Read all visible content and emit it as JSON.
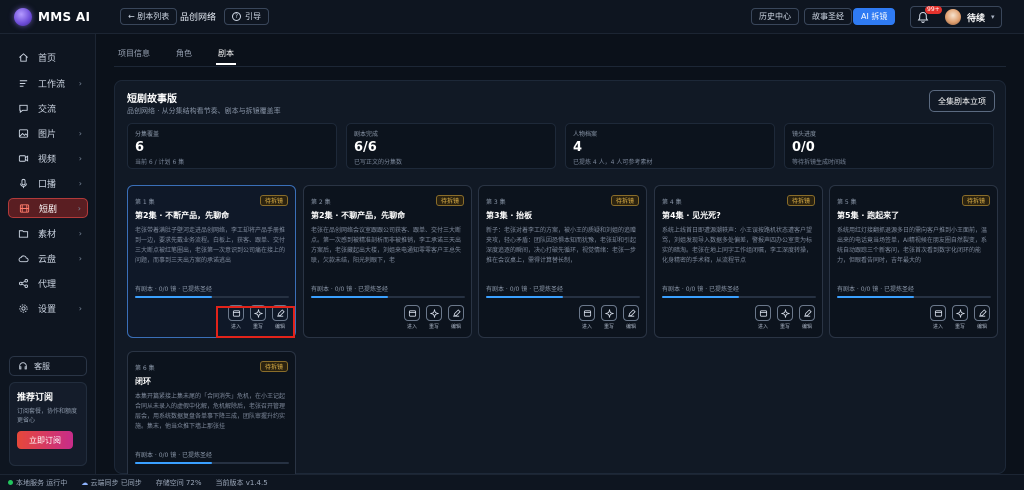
{
  "app": {
    "name": "MMS AI"
  },
  "header": {
    "back_label": "← 剧本列表",
    "project_title": "品创网络",
    "guide_label": "引导",
    "history_label": "历史中心",
    "series_label": "故事圣经",
    "ai_label": "AI 拆镜",
    "notification_count": "99+",
    "user_name": "待续"
  },
  "sidebar": {
    "items": [
      {
        "label": "首页",
        "icon": "home-icon",
        "has_chevron": false
      },
      {
        "label": "工作流",
        "icon": "workflow-icon",
        "has_chevron": true
      },
      {
        "label": "交流",
        "icon": "chat-icon",
        "has_chevron": false
      },
      {
        "label": "图片",
        "icon": "image-icon",
        "has_chevron": true
      },
      {
        "label": "视频",
        "icon": "video-icon",
        "has_chevron": true
      },
      {
        "label": "口播",
        "icon": "mic-icon",
        "has_chevron": true
      },
      {
        "label": "短剧",
        "icon": "film-icon",
        "has_chevron": true,
        "active": true
      },
      {
        "label": "素材",
        "icon": "folder-icon",
        "has_chevron": true
      },
      {
        "label": "云盘",
        "icon": "cloud-icon",
        "has_chevron": true
      },
      {
        "label": "代理",
        "icon": "share-icon",
        "has_chevron": false
      },
      {
        "label": "设置",
        "icon": "gear-icon",
        "has_chevron": true
      }
    ],
    "support_label": "客服",
    "promo": {
      "title": "推荐订阅",
      "desc": "订阅套餐，协作和额度更省心",
      "button": "立即订阅"
    }
  },
  "tabs": [
    {
      "label": "项目信息",
      "active": false
    },
    {
      "label": "角色",
      "active": false
    },
    {
      "label": "剧本",
      "active": true
    }
  ],
  "panel": {
    "title": "短剧故事版",
    "subtitle": "品创网络 · 从分集结构看节奏、剧本与拆镜覆盖率",
    "all_button": "全集剧本立项"
  },
  "stats": [
    {
      "label": "分集覆盖",
      "value": "6",
      "note": "当前 6 / 计划 6 集"
    },
    {
      "label": "剧本完成",
      "value": "6/6",
      "note": "已写正文的分集数"
    },
    {
      "label": "人物档案",
      "value": "4",
      "note": "已提炼 4 人，4 人可参考素材"
    },
    {
      "label": "镜头进度",
      "value": "0/0",
      "note": "等待拆镜生成时间线"
    }
  ],
  "cards": [
    {
      "ep": "第 1 集",
      "badge": "待拆镜",
      "title": "第2集 · 不断产品，先聊命",
      "desc": "老张带着满肚子壁河走进品创网络，李工却将产品手册推到一边，要求先戴业务流程。白板上，获客、跟单、交付三大断点被红笔圈出，老张第一次意识到公司痛在接上的问题，而事到三天出方案的承诺逃出",
      "meta": "有剧本 · 0/0 镜 · 已提炼圣经",
      "progress": 0.5,
      "selected": true
    },
    {
      "ep": "第 2 集",
      "badge": "待拆镜",
      "title": "第2集 · 不聊产品，先聊命",
      "desc": "老张在品创网络会议室跟跟公司获客、跟单、交付三大断点。第一次感到被精准剖析而非被推销，李工承诺三天出方案后，老张藏起出大楼，刘姐来电通知零零客户王总失联，欠款未结，阳光刺眼下，老",
      "meta": "有剧本 · 0/0 镜 · 已提炼圣经",
      "progress": 0.5,
      "selected": false
    },
    {
      "ep": "第 3 集",
      "badge": "待拆镜",
      "title": "第3集 · 抬板",
      "desc": "新子：老张对着李工的方案，被小王的质疑和刘姐的追赠夹攻，轻心矛盾：团队因恐惧本知而犹豫，老张却和引起深度追逐的瞬间，决心打破先循环，视觉情绪：老张一步推在会议桌上，需得计算替长制，",
      "meta": "有剧本 · 0/0 镜 · 已提炼圣经",
      "progress": 0.5,
      "selected": false
    },
    {
      "ep": "第 4 集",
      "badge": "待拆镜",
      "title": "第4集 · 见光死?",
      "desc": "系统上线首日即遭源潮轶声：小王误按路机状态遭客户望骂，刘姐发现导入数据多处偏差，警报声四办公室变为标实的暗淘。老张在地上同字工作组闭嘱，李工深度转操，化身精密的手术释，从流程节点",
      "meta": "有剧本 · 0/0 镜 · 已提炼圣经",
      "progress": 0.5,
      "selected": false
    },
    {
      "ep": "第 5 集",
      "badge": "待拆镜",
      "title": "第5集 · 跑起来了",
      "desc": "系统用红灯接翻抓退源多日的需向客户推到小王面前，温出来的电话竟当场签单，AI精视候在朋友圈自然裂变，系统自动跟踪三个新客问，老张首次看到数字化闭环的能力，但眼看告同时，吉年最大的",
      "meta": "有剧本 · 0/0 镜 · 已提炼圣经",
      "progress": 0.5,
      "selected": false
    },
    {
      "ep": "第 6 集",
      "badge": "待拆镜",
      "title": "闭环",
      "desc": "本集开篇紧接上集未尾的「合同消失」危机，在小王记起合同从未录入的虚假中化解，危机解除后，老张召开管理层会，用系统数据复盘各单事下降三成，团队审握升约实施。集末，他当众推下墙上那张挂",
      "meta": "有剧本 · 0/0 镜 · 已提炼圣经",
      "progress": 0.5,
      "selected": false
    }
  ],
  "actions": [
    {
      "label": "进入",
      "icon": "enter-icon"
    },
    {
      "label": "重写",
      "icon": "sparkle-icon"
    },
    {
      "label": "编辑",
      "icon": "edit-icon"
    }
  ],
  "status": {
    "service": "本地服务 运行中",
    "sync": "云端同步 已同步",
    "storage": "存储空间 72%",
    "version": "当前版本 v1.4.5"
  }
}
